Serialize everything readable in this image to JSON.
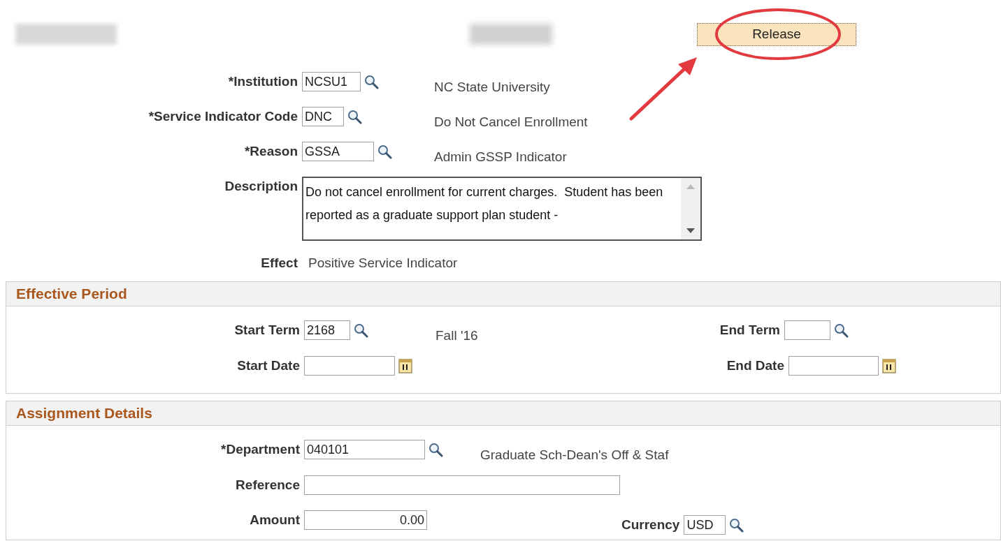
{
  "release_button": "Release",
  "header_fields": [
    {
      "label": "*Institution",
      "value": "NCSU1",
      "description": "NC State University"
    },
    {
      "label": "*Service Indicator Code",
      "value": "DNC",
      "description": "Do Not Cancel Enrollment"
    },
    {
      "label": "*Reason",
      "value": "GSSA",
      "description": "Admin GSSP Indicator"
    }
  ],
  "description": {
    "label": "Description",
    "value": "Do not cancel enrollment for current charges.  Student has been reported as a graduate support plan student -"
  },
  "effect": {
    "label": "Effect",
    "value": "Positive Service Indicator"
  },
  "effective_period": {
    "title": "Effective Period",
    "start_term": {
      "label": "Start Term",
      "value": "2168",
      "description": "Fall '16"
    },
    "end_term": {
      "label": "End Term"
    },
    "start_date": {
      "label": "Start Date"
    },
    "end_date": {
      "label": "End Date"
    }
  },
  "assignment_details": {
    "title": "Assignment Details",
    "department": {
      "label": "*Department",
      "value": "040101",
      "description": "Graduate Sch-Dean's Off & Staf"
    },
    "reference": {
      "label": "Reference"
    },
    "amount": {
      "label": "Amount",
      "value": "0.00"
    },
    "currency": {
      "label": "Currency",
      "value": "USD"
    }
  }
}
